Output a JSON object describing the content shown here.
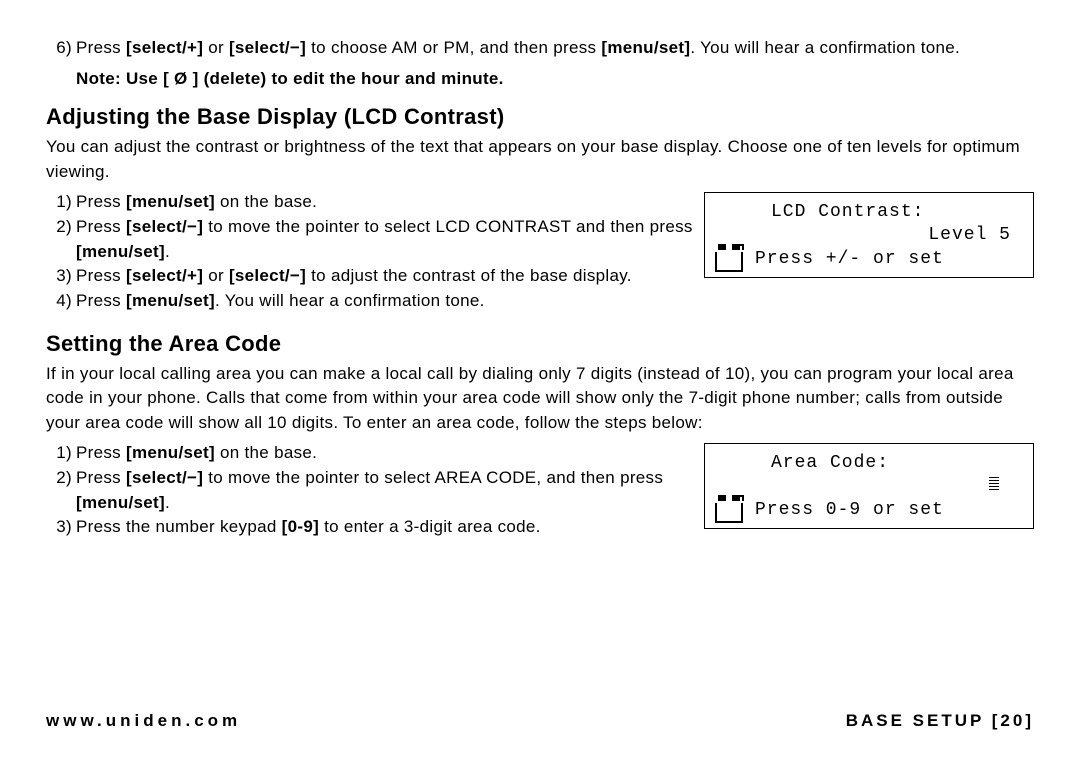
{
  "top": {
    "step6_num": "6)",
    "step6_a": "Press ",
    "step6_b": "[select/+]",
    "step6_c": " or ",
    "step6_d": "[select/−]",
    "step6_e": " to choose AM or PM, and then press ",
    "step6_f": "[menu/set]",
    "step6_g": ". You will hear a confirmation tone.",
    "note": "Note: Use [ Ø ] (delete) to edit the hour and minute."
  },
  "sec1": {
    "heading": "Adjusting the Base Display (LCD Contrast)",
    "intro": "You can adjust the contrast or brightness of the text that appears on your base display. Choose one of ten levels for optimum viewing.",
    "s1n": "1)",
    "s1a": "Press ",
    "s1b": "[menu/set]",
    "s1c": " on the base.",
    "s2n": "2)",
    "s2a": "Press ",
    "s2b": "[select/−]",
    "s2c": " to move the pointer to select LCD CONTRAST and then press ",
    "s2d": "[menu/set]",
    "s2e": ".",
    "s3n": "3)",
    "s3a": "Press ",
    "s3b": "[select/+]",
    "s3c": " or ",
    "s3d": "[select/−]",
    "s3e": " to adjust the contrast of the base display.",
    "s4n": "4)",
    "s4a": "Press ",
    "s4b": "[menu/set]",
    "s4c": ". You will hear a confirmation tone.",
    "lcd_l1": "LCD Contrast:",
    "lcd_l2": "Level 5",
    "lcd_l3": "Press +/- or set"
  },
  "sec2": {
    "heading": "Setting the Area Code",
    "intro": "If in your local calling area you can make a local call by dialing only 7 digits (instead of 10), you can program your local area code in your phone. Calls that come from within your area code will show only the 7-digit phone number; calls from outside your area code will show all 10 digits. To enter an area code, follow the steps below:",
    "s1n": "1)",
    "s1a": "Press ",
    "s1b": "[menu/set]",
    "s1c": " on the base.",
    "s2n": "2)",
    "s2a": "Press ",
    "s2b": "[select/−]",
    "s2c": " to move the pointer to select AREA CODE, and then press ",
    "s2d": "[menu/set]",
    "s2e": ".",
    "s3n": "3)",
    "s3a": "Press the number keypad ",
    "s3b": "[0-9]",
    "s3c": " to enter a 3-digit area code.",
    "lcd_l1": "Area Code:",
    "lcd_l2": "",
    "lcd_l3": "Press 0-9 or set"
  },
  "footer": {
    "url": "www.uniden.com",
    "page": "BASE SETUP [20]"
  }
}
